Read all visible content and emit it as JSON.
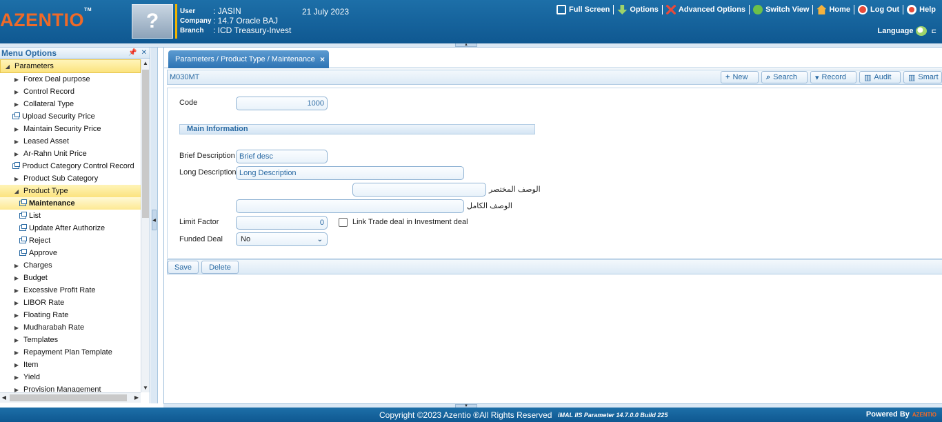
{
  "header": {
    "logo": "AZENTIO",
    "logo_tm": "TM",
    "avatar_glyph": "?",
    "user_label": "User",
    "user_value": ": JASIN",
    "company_label": "Company",
    "company_value": ": 14.7 Oracle BAJ",
    "branch_label": "Branch",
    "branch_value": ": ICD Treasury-Invest",
    "date": "21 July 2023",
    "nav": [
      {
        "label": "Full Screen",
        "icon": "fullscreen-icon",
        "color": "#ffffff"
      },
      {
        "label": "Options",
        "icon": "download-arrow-icon",
        "color": "#9ed36a"
      },
      {
        "label": "Advanced Options",
        "icon": "tools-icon",
        "color": "#e84a3a"
      },
      {
        "label": "Switch View",
        "icon": "switch-view-icon",
        "color": "#6cc04a"
      },
      {
        "label": "Home",
        "icon": "home-icon",
        "color": "#f4b23d"
      },
      {
        "label": "Log Out",
        "icon": "power-icon",
        "color": "#e84a3a"
      },
      {
        "label": "Help",
        "icon": "lifebuoy-icon",
        "color": "#ffffff"
      }
    ],
    "language": "Language"
  },
  "menu": {
    "title": "Menu Options",
    "root": "Parameters",
    "items": [
      {
        "label": "Forex Deal purpose",
        "kind": "folder"
      },
      {
        "label": "Control Record",
        "kind": "folder"
      },
      {
        "label": "Collateral Type",
        "kind": "folder"
      },
      {
        "label": "Upload Security Price",
        "kind": "page"
      },
      {
        "label": "Maintain Security Price",
        "kind": "folder"
      },
      {
        "label": "Leased Asset",
        "kind": "folder"
      },
      {
        "label": "Ar-Rahn Unit Price",
        "kind": "folder"
      },
      {
        "label": "Product Category Control Record",
        "kind": "page"
      },
      {
        "label": "Product Sub Category",
        "kind": "folder"
      },
      {
        "label": "Product Type",
        "kind": "open"
      },
      {
        "label": "Maintenance",
        "kind": "child-active"
      },
      {
        "label": "List",
        "kind": "child"
      },
      {
        "label": "Update After Authorize",
        "kind": "child"
      },
      {
        "label": "Reject",
        "kind": "child"
      },
      {
        "label": "Approve",
        "kind": "child"
      },
      {
        "label": "Charges",
        "kind": "folder"
      },
      {
        "label": "Budget",
        "kind": "folder"
      },
      {
        "label": "Excessive Profit Rate",
        "kind": "folder"
      },
      {
        "label": "LIBOR Rate",
        "kind": "folder"
      },
      {
        "label": "Floating Rate",
        "kind": "folder"
      },
      {
        "label": "Mudharabah Rate",
        "kind": "folder"
      },
      {
        "label": "Templates",
        "kind": "folder"
      },
      {
        "label": "Repayment Plan Template",
        "kind": "folder"
      },
      {
        "label": "Item",
        "kind": "folder"
      },
      {
        "label": "Yield",
        "kind": "folder"
      },
      {
        "label": "Provision Management",
        "kind": "folder"
      }
    ]
  },
  "tab": {
    "label": "Parameters / Product Type / Maintenance",
    "close": "×"
  },
  "toolbar": {
    "screen_code": "M030MT",
    "buttons": [
      {
        "label": "New",
        "icon": "+"
      },
      {
        "label": "Search",
        "icon": "⌕"
      },
      {
        "label": "Record",
        "icon": "▾"
      },
      {
        "label": "Audit",
        "icon": "▥"
      },
      {
        "label": "Smart",
        "icon": "▥"
      }
    ]
  },
  "form": {
    "code_label": "Code",
    "code_value": "1000",
    "section_title": "Main Information",
    "brief_label": "Brief Description",
    "brief_value": "Brief desc",
    "long_label": "Long Description",
    "long_value": "Long Description",
    "arabic_brief_label": "الوصف المختصر",
    "arabic_brief_value": "",
    "arabic_long_label": "الوصف الكامل",
    "arabic_long_value": "",
    "limit_label": "Limit Factor",
    "limit_value": "0",
    "link_trade_label": "Link Trade deal in Investment deal",
    "link_trade_checked": false,
    "funded_label": "Funded Deal",
    "funded_value": "No"
  },
  "actions": {
    "save": "Save",
    "delete": "Delete"
  },
  "footer": {
    "copyright": "Copyright ©2023 Azentio ®All Rights Reserved",
    "build": "iMAL IIS Parameter 14.7.0.0 Build 225",
    "powered": "Powered By",
    "powered_logo": "AZENTIO"
  }
}
